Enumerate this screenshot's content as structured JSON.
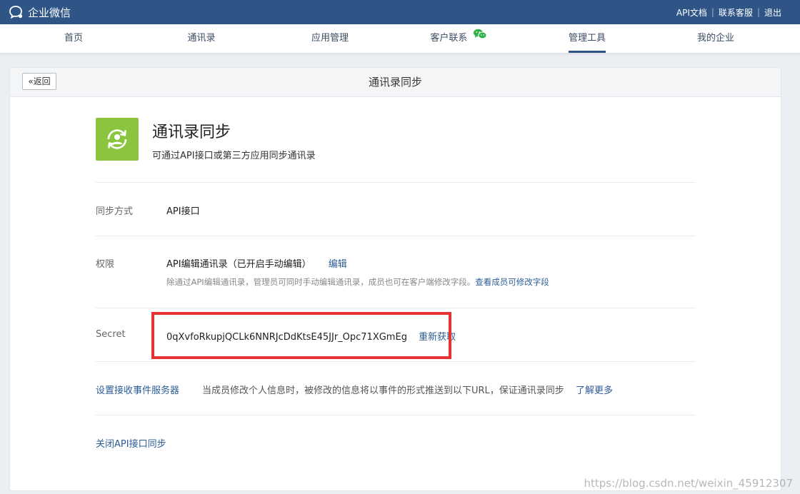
{
  "topbar": {
    "app_name": "企业微信",
    "links": [
      "API文档",
      "联系客服",
      "退出"
    ]
  },
  "nav": {
    "items": [
      "首页",
      "通讯录",
      "应用管理",
      "客户联系",
      "管理工具",
      "我的企业"
    ],
    "active": "管理工具"
  },
  "page": {
    "back_label": "返回",
    "title": "通讯录同步"
  },
  "app": {
    "name": "通讯录同步",
    "description": "可通过API接口或第三方应用同步通讯录",
    "icon": "sync-contacts-icon",
    "icon_color": "#8bc53f"
  },
  "sync_method": {
    "label": "同步方式",
    "value": "API接口"
  },
  "permission": {
    "label": "权限",
    "value": "API编辑通讯录（已开启手动编辑）",
    "edit_label": "编辑",
    "hint": "除通过API编辑通讯录，管理员可同时手动编辑通讯录，成员也可在客户端修改字段。",
    "hint_link": "查看成员可修改字段"
  },
  "secret": {
    "label": "Secret",
    "value": "0qXvfoRkupjQCLk6NNRJcDdKtsE45JJr_Opc71XGmEg",
    "refresh_label": "重新获取"
  },
  "event_server": {
    "label": "设置接收事件服务器",
    "description": "当成员修改个人信息时，被修改的信息将以事件的形式推送到以下URL，保证通讯录同步",
    "learn_more": "了解更多"
  },
  "close_api": {
    "label": "关闭API接口同步"
  },
  "watermark": "https://blog.csdn.net/weixin_45912307",
  "colors": {
    "topbar": "#2f5587",
    "link": "#2c5c96",
    "highlight": "#e73232"
  }
}
